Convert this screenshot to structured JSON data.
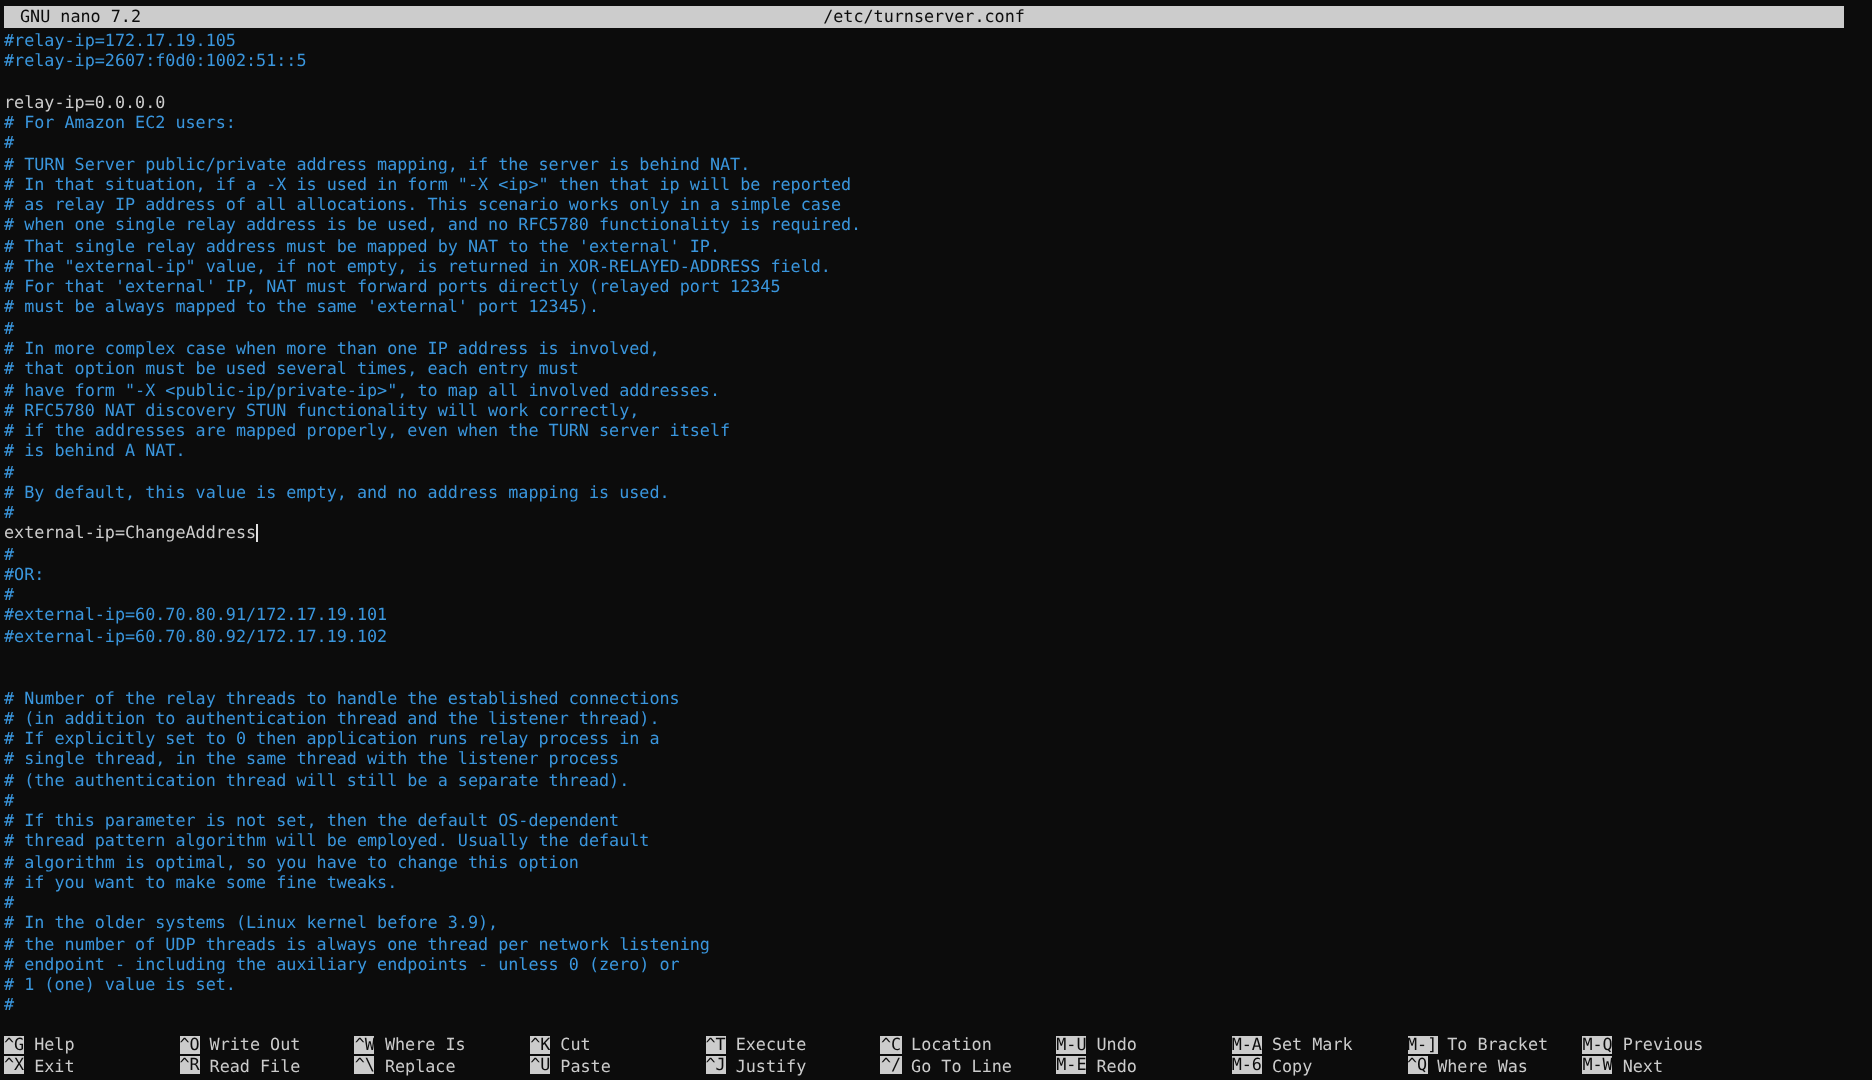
{
  "title_bar": {
    "app": "GNU nano 7.2",
    "file": "/etc/turnserver.conf"
  },
  "lines": [
    {
      "kind": "comment",
      "text": "#relay-ip=172.17.19.105",
      "cursor": false
    },
    {
      "kind": "comment",
      "text": "#relay-ip=2607:f0d0:1002:51::5",
      "cursor": false
    },
    {
      "kind": "blank",
      "cursor": false
    },
    {
      "kind": "setting",
      "text": "relay-ip=0.0.0.0",
      "cursor": false
    },
    {
      "kind": "comment",
      "text": "# For Amazon EC2 users:",
      "cursor": false
    },
    {
      "kind": "comment",
      "text": "#",
      "cursor": false
    },
    {
      "kind": "comment",
      "text": "# TURN Server public/private address mapping, if the server is behind NAT.",
      "cursor": false
    },
    {
      "kind": "comment",
      "text": "# In that situation, if a -X is used in form \"-X <ip>\" then that ip will be reported",
      "cursor": false
    },
    {
      "kind": "comment",
      "text": "# as relay IP address of all allocations. This scenario works only in a simple case",
      "cursor": false
    },
    {
      "kind": "comment",
      "text": "# when one single relay address is be used, and no RFC5780 functionality is required.",
      "cursor": false
    },
    {
      "kind": "comment",
      "text": "# That single relay address must be mapped by NAT to the 'external' IP.",
      "cursor": false
    },
    {
      "kind": "comment",
      "text": "# The \"external-ip\" value, if not empty, is returned in XOR-RELAYED-ADDRESS field.",
      "cursor": false
    },
    {
      "kind": "comment",
      "text": "# For that 'external' IP, NAT must forward ports directly (relayed port 12345",
      "cursor": false
    },
    {
      "kind": "comment",
      "text": "# must be always mapped to the same 'external' port 12345).",
      "cursor": false
    },
    {
      "kind": "comment",
      "text": "#",
      "cursor": false
    },
    {
      "kind": "comment",
      "text": "# In more complex case when more than one IP address is involved,",
      "cursor": false
    },
    {
      "kind": "comment",
      "text": "# that option must be used several times, each entry must",
      "cursor": false
    },
    {
      "kind": "comment",
      "text": "# have form \"-X <public-ip/private-ip>\", to map all involved addresses.",
      "cursor": false
    },
    {
      "kind": "comment",
      "text": "# RFC5780 NAT discovery STUN functionality will work correctly,",
      "cursor": false
    },
    {
      "kind": "comment",
      "text": "# if the addresses are mapped properly, even when the TURN server itself",
      "cursor": false
    },
    {
      "kind": "comment",
      "text": "# is behind A NAT.",
      "cursor": false
    },
    {
      "kind": "comment",
      "text": "#",
      "cursor": false
    },
    {
      "kind": "comment",
      "text": "# By default, this value is empty, and no address mapping is used.",
      "cursor": false
    },
    {
      "kind": "comment",
      "text": "#",
      "cursor": false
    },
    {
      "kind": "setting",
      "text": "external-ip=ChangeAddress",
      "cursor": true
    },
    {
      "kind": "comment",
      "text": "#",
      "cursor": false
    },
    {
      "kind": "comment",
      "text": "#OR:",
      "cursor": false
    },
    {
      "kind": "comment",
      "text": "#",
      "cursor": false
    },
    {
      "kind": "comment",
      "text": "#external-ip=60.70.80.91/172.17.19.101",
      "cursor": false
    },
    {
      "kind": "comment",
      "text": "#external-ip=60.70.80.92/172.17.19.102",
      "cursor": false
    },
    {
      "kind": "blank",
      "cursor": false
    },
    {
      "kind": "blank",
      "cursor": false
    },
    {
      "kind": "comment",
      "text": "# Number of the relay threads to handle the established connections",
      "cursor": false
    },
    {
      "kind": "comment",
      "text": "# (in addition to authentication thread and the listener thread).",
      "cursor": false
    },
    {
      "kind": "comment",
      "text": "# If explicitly set to 0 then application runs relay process in a",
      "cursor": false
    },
    {
      "kind": "comment",
      "text": "# single thread, in the same thread with the listener process",
      "cursor": false
    },
    {
      "kind": "comment",
      "text": "# (the authentication thread will still be a separate thread).",
      "cursor": false
    },
    {
      "kind": "comment",
      "text": "#",
      "cursor": false
    },
    {
      "kind": "comment",
      "text": "# If this parameter is not set, then the default OS-dependent",
      "cursor": false
    },
    {
      "kind": "comment",
      "text": "# thread pattern algorithm will be employed. Usually the default",
      "cursor": false
    },
    {
      "kind": "comment",
      "text": "# algorithm is optimal, so you have to change this option",
      "cursor": false
    },
    {
      "kind": "comment",
      "text": "# if you want to make some fine tweaks.",
      "cursor": false
    },
    {
      "kind": "comment",
      "text": "#",
      "cursor": false
    },
    {
      "kind": "comment",
      "text": "# In the older systems (Linux kernel before 3.9),",
      "cursor": false
    },
    {
      "kind": "comment",
      "text": "# the number of UDP threads is always one thread per network listening",
      "cursor": false
    },
    {
      "kind": "comment",
      "text": "# endpoint - including the auxiliary endpoints - unless 0 (zero) or",
      "cursor": false
    },
    {
      "kind": "comment",
      "text": "# 1 (one) value is set.",
      "cursor": false
    },
    {
      "kind": "comment",
      "text": "#",
      "cursor": false
    }
  ],
  "shortcuts": [
    [
      {
        "key": "^G",
        "label": "Help"
      },
      {
        "key": "^X",
        "label": "Exit"
      }
    ],
    [
      {
        "key": "^O",
        "label": "Write Out"
      },
      {
        "key": "^R",
        "label": "Read File"
      }
    ],
    [
      {
        "key": "^W",
        "label": "Where Is"
      },
      {
        "key": "^\\",
        "label": "Replace"
      }
    ],
    [
      {
        "key": "^K",
        "label": "Cut"
      },
      {
        "key": "^U",
        "label": "Paste"
      }
    ],
    [
      {
        "key": "^T",
        "label": "Execute"
      },
      {
        "key": "^J",
        "label": "Justify"
      }
    ],
    [
      {
        "key": "^C",
        "label": "Location"
      },
      {
        "key": "^/",
        "label": "Go To Line"
      }
    ],
    [
      {
        "key": "M-U",
        "label": "Undo"
      },
      {
        "key": "M-E",
        "label": "Redo"
      }
    ],
    [
      {
        "key": "M-A",
        "label": "Set Mark"
      },
      {
        "key": "M-6",
        "label": "Copy"
      }
    ],
    [
      {
        "key": "M-]",
        "label": "To Bracket"
      },
      {
        "key": "^Q",
        "label": "Where Was"
      }
    ],
    [
      {
        "key": "M-Q",
        "label": "Previous"
      },
      {
        "key": "M-W",
        "label": "Next"
      }
    ]
  ]
}
